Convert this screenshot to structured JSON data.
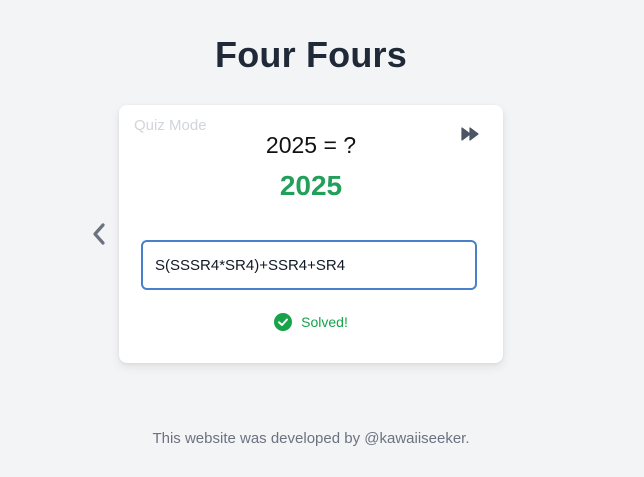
{
  "page": {
    "title": "Four Fours",
    "footer": "This website was developed by @kawaiiseeker."
  },
  "card": {
    "mode_label": "Quiz Mode",
    "question": "2025 = ?",
    "target": "2025",
    "expression_value": "S(SSSR4*SR4)+SSR4+SR4",
    "status_text": "Solved!"
  },
  "icons": {
    "prev": "chevron-left-icon",
    "skip": "fast-forward-icon",
    "status": "check-circle-icon"
  },
  "colors": {
    "title": "#1f2937",
    "success": "#22a05a",
    "input_border": "#4a7fc9",
    "muted": "#d1d5db",
    "icon": "#4b5563"
  }
}
